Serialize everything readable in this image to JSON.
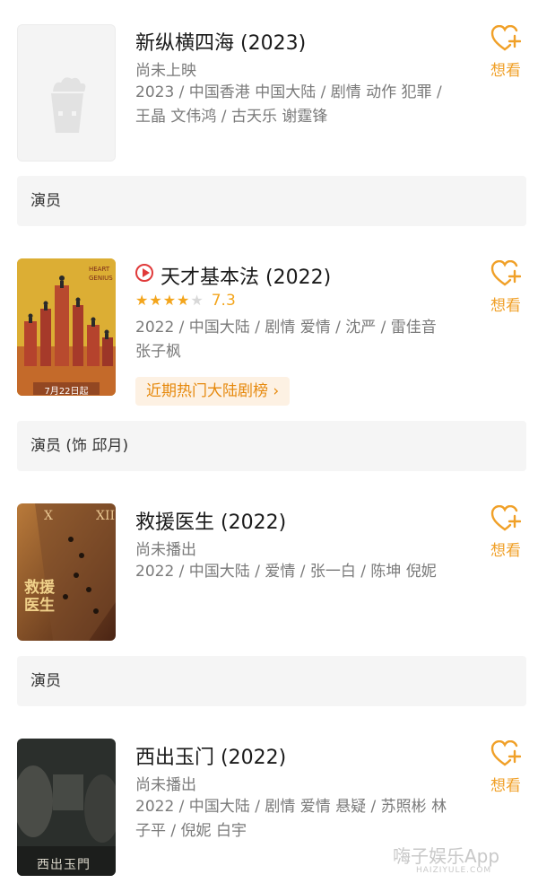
{
  "want_label": "想看",
  "items": [
    {
      "title": "新纵横四海 (2023)",
      "status": "尚未上映",
      "meta": "2023 / 中国香港 中国大陆 / 剧情 动作 犯罪 / 王晶 文伟鸿 / 古天乐 谢霆锋",
      "role": "演员",
      "poster_icon": "popcorn-placeholder-icon"
    },
    {
      "title": "天才基本法 (2022)",
      "rating": "7.3",
      "stars": 3.5,
      "meta": "2022 / 中国大陆 / 剧情 爱情 / 沈严 / 雷佳音 张子枫",
      "rank": "近期热门大陆剧榜 ›",
      "role": "演员 (饰 邱月)",
      "poster_text": {
        "top": "HEART GENIUS",
        "date": "7月22日起"
      }
    },
    {
      "title": "救援医生 (2022)",
      "status": "尚未播出",
      "meta": "2022 / 中国大陆 / 爱情 / 张一白 / 陈坤 倪妮",
      "role": "演员",
      "poster_text": {
        "title": "救援医生"
      }
    },
    {
      "title": "西出玉门 (2022)",
      "status": "尚未播出",
      "meta": "2022 / 中国大陆 / 剧情 爱情 悬疑 / 苏照彬 林子平 / 倪妮 白宇",
      "poster_text": {
        "title": "西出玉門"
      }
    }
  ],
  "watermark": {
    "main": "嗨子娱乐App",
    "sub": "HAIZIYULE.COM"
  },
  "colors": {
    "accent": "#f0a028",
    "role_bg": "#f5f5f5",
    "rank_chip": "#fdf1e3"
  }
}
